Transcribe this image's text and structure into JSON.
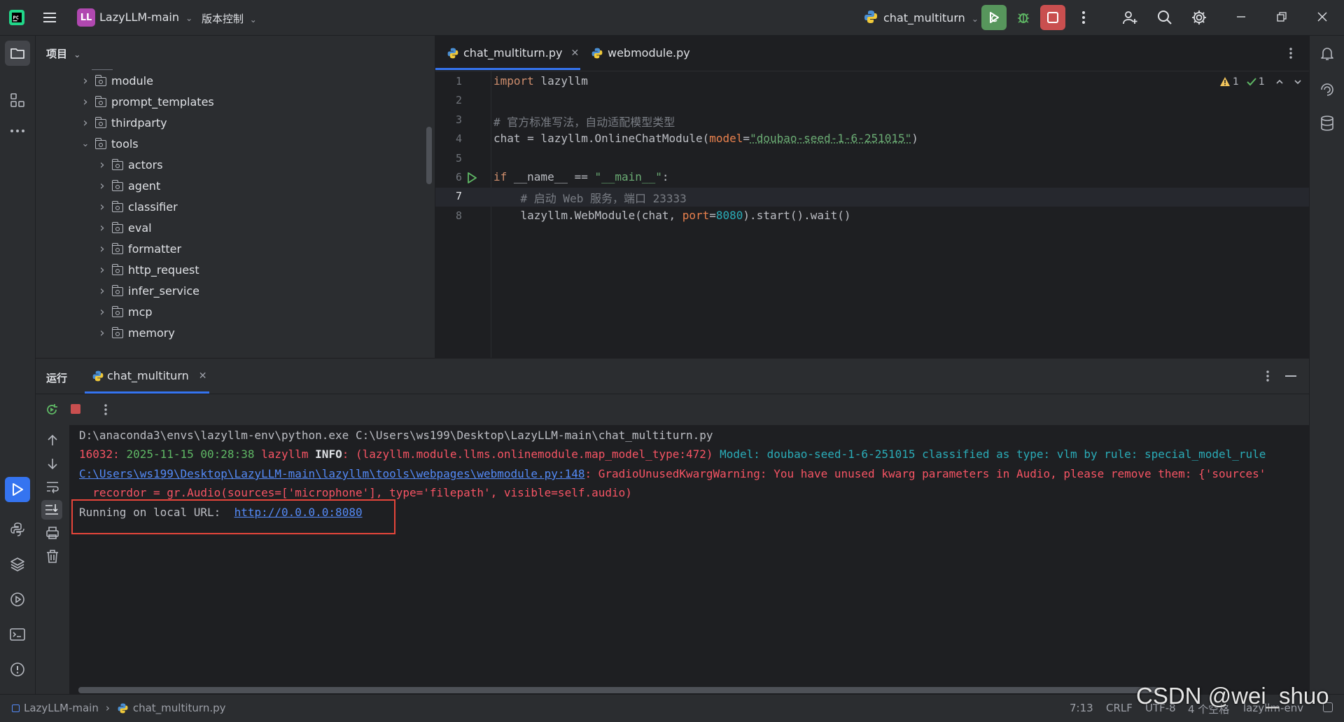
{
  "topbar": {
    "project_initials": "LL",
    "project_name": "LazyLLM-main",
    "vcs_label": "版本控制",
    "run_config": "chat_multiturn"
  },
  "project_panel": {
    "title": "项目",
    "items": [
      {
        "label": "module",
        "level": 0,
        "expanded": false
      },
      {
        "label": "prompt_templates",
        "level": 0,
        "expanded": false
      },
      {
        "label": "thirdparty",
        "level": 0,
        "expanded": false
      },
      {
        "label": "tools",
        "level": 0,
        "expanded": true
      },
      {
        "label": "actors",
        "level": 1,
        "expanded": false
      },
      {
        "label": "agent",
        "level": 1,
        "expanded": false
      },
      {
        "label": "classifier",
        "level": 1,
        "expanded": false
      },
      {
        "label": "eval",
        "level": 1,
        "expanded": false
      },
      {
        "label": "formatter",
        "level": 1,
        "expanded": false
      },
      {
        "label": "http_request",
        "level": 1,
        "expanded": false
      },
      {
        "label": "infer_service",
        "level": 1,
        "expanded": false
      },
      {
        "label": "mcp",
        "level": 1,
        "expanded": false
      },
      {
        "label": "memory",
        "level": 1,
        "expanded": false
      }
    ]
  },
  "editor": {
    "tabs": [
      {
        "label": "chat_multiturn.py",
        "active": true
      },
      {
        "label": "webmodule.py",
        "active": false
      }
    ],
    "inspections": {
      "warnings": "1",
      "ok": "1"
    },
    "line_numbers": [
      "1",
      "2",
      "3",
      "4",
      "5",
      "6",
      "7",
      "8"
    ],
    "code": {
      "l1_kw": "import",
      "l1_rest": " lazyllm",
      "l3": "# 官方标准写法，自动适配模型类型",
      "l4_a": "chat = lazyllm.OnlineChatModule(",
      "l4_param": "model",
      "l4_eq": "=",
      "l4_str": "\"doubao-seed-1-6-251015\"",
      "l4_end": ")",
      "l6_kw": "if",
      "l6_a": " __name__ == ",
      "l6_str": "\"__main__\"",
      "l6_end": ":",
      "l7": "    # 启动 Web 服务，端口 23333",
      "l8_a": "    lazyllm.WebModule(chat, ",
      "l8_param": "port",
      "l8_eq": "=",
      "l8_num": "8080",
      "l8_end": ").start().wait()"
    }
  },
  "run_panel": {
    "title": "运行",
    "tab": "chat_multiturn",
    "console": {
      "line1": "D:\\anaconda3\\envs\\lazyllm-env\\python.exe C:\\Users\\ws199\\Desktop\\LazyLLM-main\\chat_multiturn.py",
      "line2_pid": "16032: ",
      "line2_time": "2025-11-15 00:28:38",
      "line2_name": " lazyllm ",
      "line2_level": "INFO",
      "line2_src": ": (lazyllm.module.llms.onlinemodule.map_model_type:472) ",
      "line2_msg": "Model: doubao-seed-1-6-251015 classified as type: vlm by rule: special_model_rule",
      "line3_link": "C:\\Users\\ws199\\Desktop\\LazyLLM-main\\lazyllm\\tools\\webpages\\webmodule.py:148",
      "line3_msg": ": GradioUnusedKwargWarning: You have unused kwarg parameters in Audio, please remove them: {'sources'",
      "line4": "  recordor = gr.Audio(sources=['microphone'], type='filepath', visible=self.audio)",
      "line5_label": "Running on local URL:  ",
      "line5_url": "http://0.0.0.0:8080"
    }
  },
  "statusbar": {
    "project": "LazyLLM-main",
    "file": "chat_multiturn.py",
    "position": "7:13",
    "line_sep": "CRLF",
    "encoding": "UTF-8",
    "indent": "4 个空格",
    "interpreter": "lazyllm-env"
  },
  "watermark": "CSDN @wei_shuo",
  "colors": {
    "accent": "#3574f0",
    "run_green": "#57965c",
    "stop_red": "#c94f4f",
    "highlight_box": "#e5453a"
  }
}
